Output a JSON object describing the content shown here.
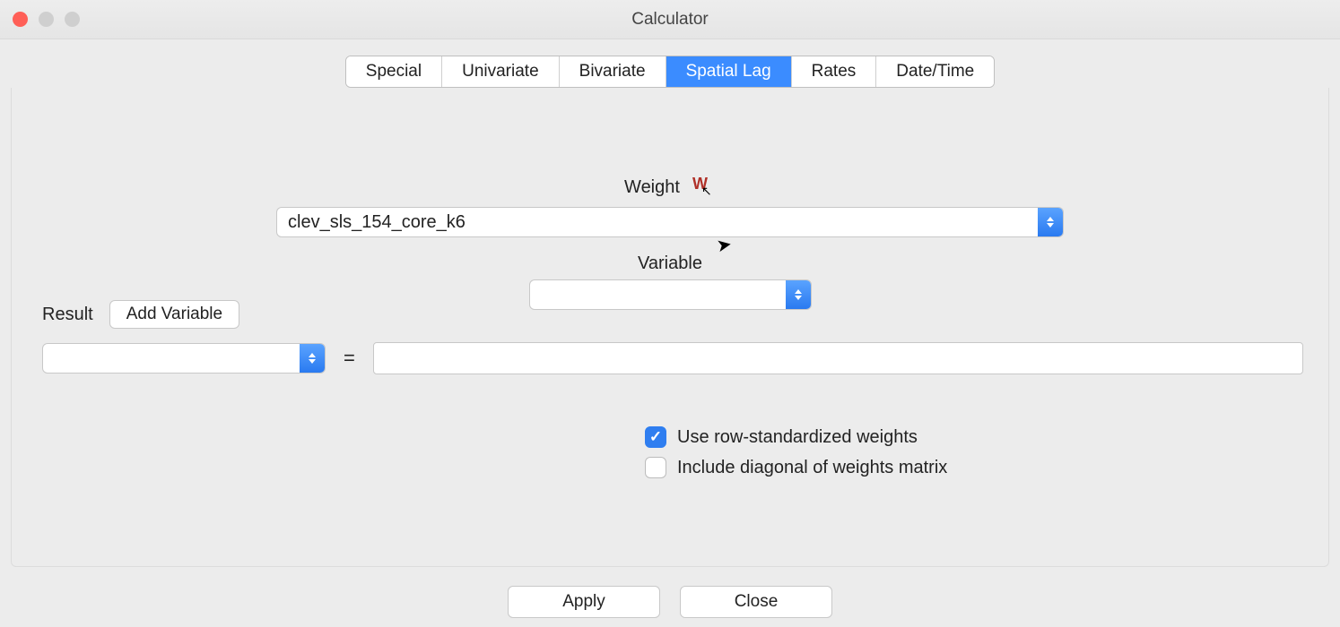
{
  "window": {
    "title": "Calculator"
  },
  "tabs": {
    "special": "Special",
    "univariate": "Univariate",
    "bivariate": "Bivariate",
    "spatial_lag": "Spatial Lag",
    "rates": "Rates",
    "datetime": "Date/Time",
    "active": "spatial_lag"
  },
  "weight": {
    "label": "Weight",
    "selected": "clev_sls_154_core_k6"
  },
  "variable": {
    "label": "Variable",
    "selected": ""
  },
  "result": {
    "label": "Result",
    "add_button": "Add Variable",
    "selected": "",
    "equals": "=",
    "formula": ""
  },
  "options": {
    "row_std": {
      "label": "Use row-standardized weights",
      "checked": true
    },
    "diag": {
      "label": "Include diagonal of weights matrix",
      "checked": false
    }
  },
  "buttons": {
    "apply": "Apply",
    "close": "Close"
  }
}
